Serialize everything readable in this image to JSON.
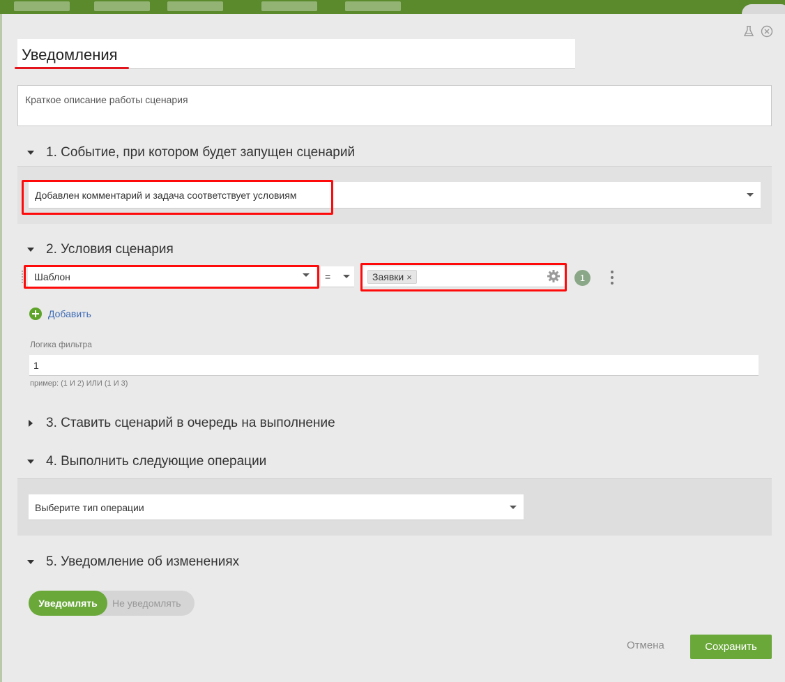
{
  "modal": {
    "title": "Уведомления",
    "description_placeholder": "Краткое описание работы сценария"
  },
  "section1": {
    "heading": "1. Событие, при котором будет запущен сценарий",
    "event_value": "Добавлен комментарий и задача соответствует условиям"
  },
  "section2": {
    "heading": "2. Условия сценария",
    "field_value": "Шаблон",
    "operator_value": "=",
    "tag_value": "Заявки",
    "tag_remove": "×",
    "condition_number": "1",
    "add_label": "Добавить",
    "logic_label": "Логика фильтра",
    "logic_value": "1",
    "logic_hint": "пример: (1 И 2) ИЛИ (1 И 3)"
  },
  "section3": {
    "heading": "3. Ставить сценарий в очередь на выполнение"
  },
  "section4": {
    "heading": "4. Выполнить следующие операции",
    "operation_placeholder": "Выберите тип операции"
  },
  "section5": {
    "heading": "5. Уведомление об изменениях",
    "option_on": "Уведомлять",
    "option_off": "Не уведомлять",
    "selected": "Уведомлять"
  },
  "footer": {
    "cancel_label": "Отмена",
    "save_label": "Сохранить"
  },
  "colors": {
    "accent": "#6aa83a",
    "highlight": "#ff0a0a",
    "link": "#3e6bb5"
  },
  "icons": {
    "top_left": "flask-icon",
    "top_right": "close-circle-icon",
    "gear": "gear-icon",
    "add": "plus-circle-icon"
  }
}
